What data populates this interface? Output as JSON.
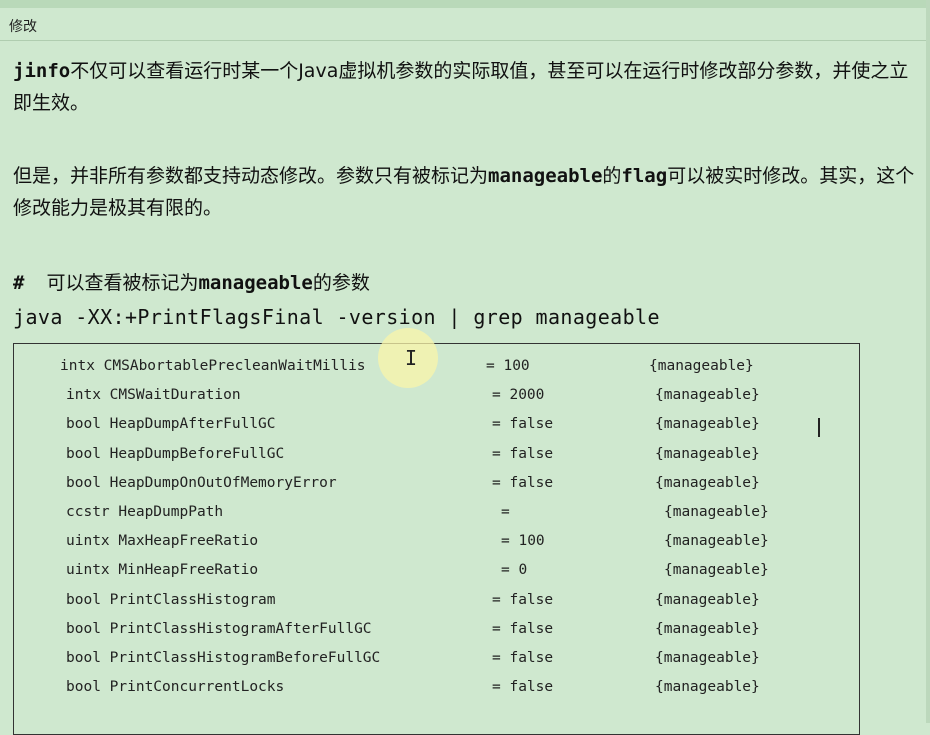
{
  "window": {
    "title": "修改"
  },
  "paragraph1": {
    "cmd": "jinfo",
    "text": "不仅可以查看运行时某一个Java虚拟机参数的实际取值，甚至可以在运行时修改部分参数，并使之立即生效。"
  },
  "paragraph2": {
    "pre": "但是，并非所有参数都支持动态修改。参数只有被标记为",
    "kw1": "manageable",
    "mid": "的",
    "kw2": "flag",
    "post": "可以被实时修改。其实，这个修改能力是极其有限的。"
  },
  "comment": {
    "hash": "#",
    "pre": "可以查看被标记为",
    "kw": "manageable",
    "post": "的参数"
  },
  "command": "java -XX:+PrintFlagsFinal -version | grep manageable",
  "flags": [
    {
      "type_name": "intx CMSAbortablePrecleanWaitMillis",
      "value": "= 100",
      "tag": "{manageable}"
    },
    {
      "type_name": "intx CMSWaitDuration",
      "value": "= 2000",
      "tag": "{manageable}"
    },
    {
      "type_name": "bool HeapDumpAfterFullGC",
      "value": "= false",
      "tag": "{manageable}"
    },
    {
      "type_name": "bool HeapDumpBeforeFullGC",
      "value": "= false",
      "tag": "{manageable}"
    },
    {
      "type_name": "bool HeapDumpOnOutOfMemoryError",
      "value": "= false",
      "tag": "{manageable}"
    },
    {
      "type_name": "ccstr HeapDumpPath",
      "value": "=",
      "tag": "{manageable}"
    },
    {
      "type_name": "uintx MaxHeapFreeRatio",
      "value": "= 100",
      "tag": "{manageable}"
    },
    {
      "type_name": "uintx MinHeapFreeRatio",
      "value": "= 0",
      "tag": "{manageable}"
    },
    {
      "type_name": "bool PrintClassHistogram",
      "value": "= false",
      "tag": "{manageable}"
    },
    {
      "type_name": "bool PrintClassHistogramAfterFullGC",
      "value": "= false",
      "tag": "{manageable}"
    },
    {
      "type_name": "bool PrintClassHistogramBeforeFullGC",
      "value": "= false",
      "tag": "{manageable}"
    },
    {
      "type_name": "bool PrintConcurrentLocks",
      "value": "= false",
      "tag": "{manageable}"
    }
  ],
  "colors": {
    "background": "#cfe8cf",
    "text": "#111111"
  }
}
